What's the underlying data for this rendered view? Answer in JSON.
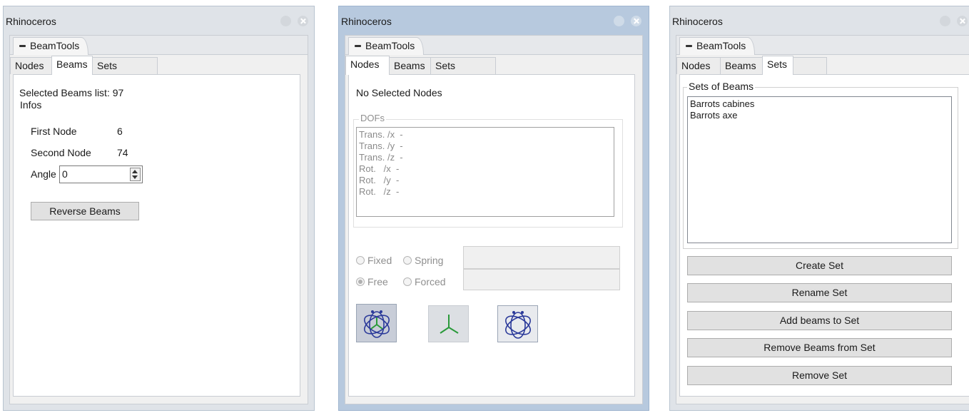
{
  "windows": [
    {
      "title": "Rhinoceros",
      "plugin_tab": "BeamTools",
      "tabs": [
        "Nodes",
        "Beams",
        "Sets"
      ],
      "active_tab": "Beams",
      "selected_label": "Selected Beams list: 97",
      "infos_legend": "Infos",
      "first_node_label": "First Node",
      "first_node_value": "6",
      "second_node_label": "Second Node",
      "second_node_value": "74",
      "angle_label": "Angle",
      "angle_value": "0",
      "reverse_button": "Reverse Beams"
    },
    {
      "title": "Rhinoceros",
      "plugin_tab": "BeamTools",
      "tabs": [
        "Nodes",
        "Beams",
        "Sets"
      ],
      "active_tab": "Nodes",
      "status": "No Selected Nodes",
      "dofs_legend": "DOFs",
      "dofs": [
        "Trans. /x  -",
        "Trans. /y  -",
        "Trans. /z  -",
        "Rot.   /x  -",
        "Rot.   /y  -",
        "Rot.   /z  -"
      ],
      "radio_fixed": "Fixed",
      "radio_spring": "Spring",
      "radio_free": "Free",
      "radio_forced": "Forced",
      "selected_radio": "Free",
      "icons": [
        "orbit-icon",
        "axes-icon",
        "orbit-icon"
      ]
    },
    {
      "title": "Rhinoceros",
      "plugin_tab": "BeamTools",
      "tabs": [
        "Nodes",
        "Beams",
        "Sets"
      ],
      "active_tab": "Sets",
      "sets_legend": "Sets of Beams",
      "sets": [
        "Barrots cabines",
        "Barrots axe"
      ],
      "buttons": [
        "Create Set",
        "Rename Set",
        "Add beams to Set",
        "Remove Beams from Set",
        "Remove Set"
      ]
    }
  ],
  "colors": {
    "active_title_bg": "#b7c9de",
    "inactive_title_bg": "#dfe3e8",
    "icon_blue": "#2b3a9a",
    "icon_green": "#2a9a3a"
  }
}
